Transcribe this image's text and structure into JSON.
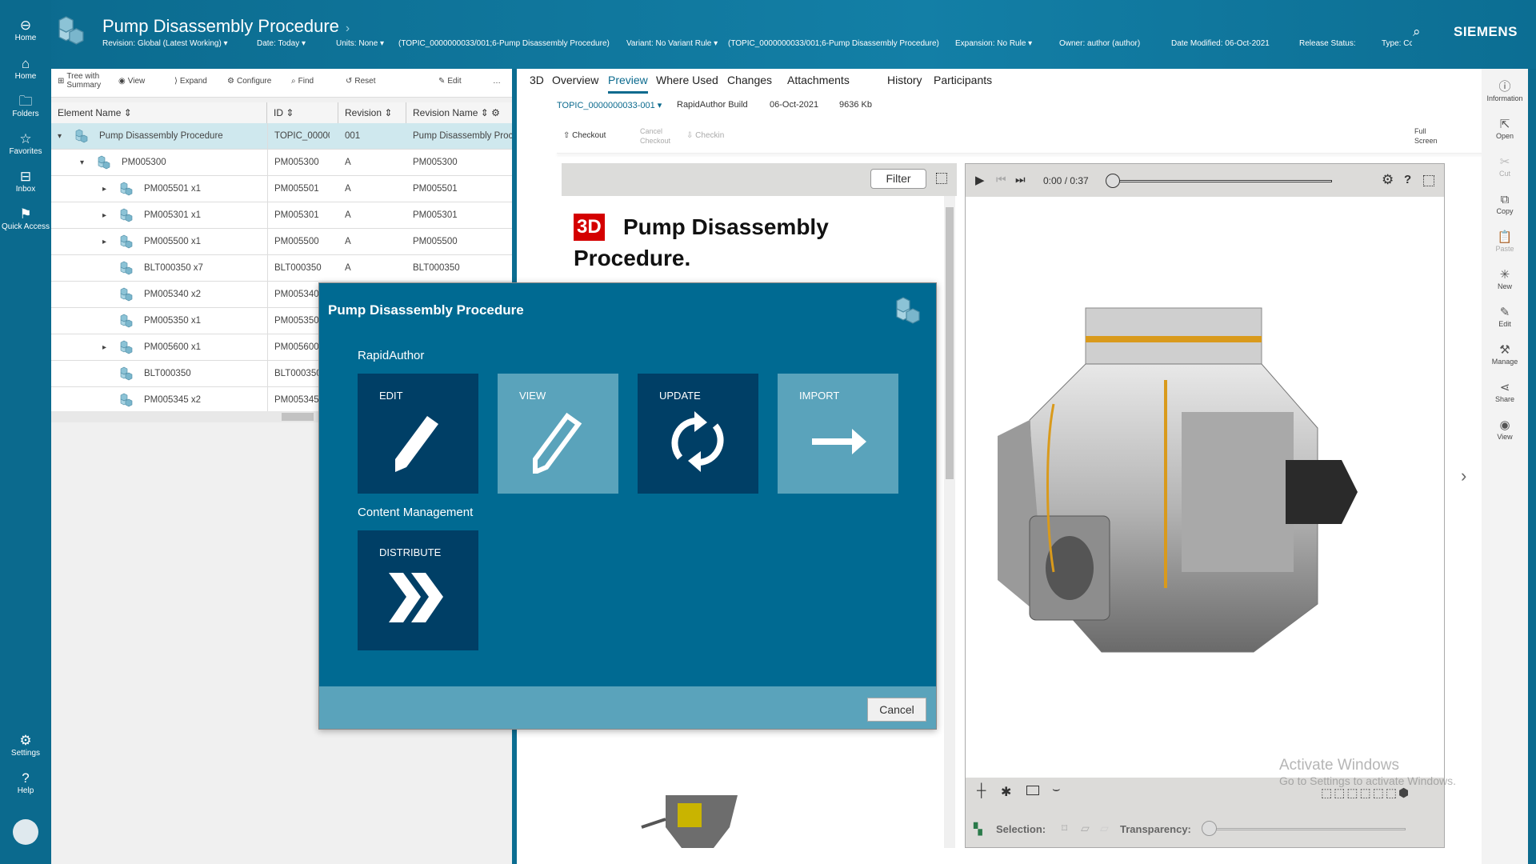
{
  "header": {
    "title": "Pump Disassembly Procedure",
    "brand": "SIEMENS",
    "meta": [
      {
        "label": "Revision:",
        "value": "Global (Latest Working)"
      },
      {
        "label": "Date:",
        "value": "Today"
      },
      {
        "label": "Units:",
        "value": "None"
      },
      {
        "label": "",
        "value": "(TOPIC_0000000033/001;6-Pump Disassembly Procedure)"
      },
      {
        "label": "Variant:",
        "value": "No Variant Rule"
      },
      {
        "label": "",
        "value": "(TOPIC_0000000033/001;6-Pump Disassembly Procedure)"
      },
      {
        "label": "Expansion:",
        "value": "No Rule"
      },
      {
        "label": "Owner:",
        "value": "author (author)"
      },
      {
        "label": "Date Modified:",
        "value": "06-Oct-2021"
      },
      {
        "label": "Release Status:",
        "value": ""
      },
      {
        "label": "Type:",
        "value": "Cc"
      }
    ]
  },
  "leftnav": {
    "items": [
      "Home",
      "Home",
      "Folders",
      "Favorites",
      "Inbox",
      "Quick Access"
    ],
    "bottom": [
      "Settings",
      "Help"
    ]
  },
  "tree_toolbar": {
    "tree": "Tree with Summary",
    "view": "View",
    "expand": "Expand",
    "configure": "Configure",
    "find": "Find",
    "reset": "Reset",
    "edit": "Edit",
    "more": "…"
  },
  "table": {
    "columns": [
      "Element Name",
      "ID",
      "Revision",
      "Revision Name"
    ],
    "rows": [
      {
        "name": "Pump Disassembly Procedure",
        "id": "TOPIC_00000...",
        "rev": "001",
        "revname": "Pump Disassembly Proc",
        "level": 0,
        "toggle": "▾"
      },
      {
        "name": "PM005300",
        "id": "PM005300",
        "rev": "A",
        "revname": "PM005300",
        "level": 1,
        "toggle": "▾"
      },
      {
        "name": "PM005501 x1",
        "id": "PM005501",
        "rev": "A",
        "revname": "PM005501",
        "level": 2,
        "toggle": "▸"
      },
      {
        "name": "PM005301 x1",
        "id": "PM005301",
        "rev": "A",
        "revname": "PM005301",
        "level": 2,
        "toggle": "▸"
      },
      {
        "name": "PM005500 x1",
        "id": "PM005500",
        "rev": "A",
        "revname": "PM005500",
        "level": 2,
        "toggle": "▸"
      },
      {
        "name": "BLT000350 x7",
        "id": "BLT000350",
        "rev": "A",
        "revname": "BLT000350",
        "level": 2,
        "toggle": ""
      },
      {
        "name": "PM005340 x2",
        "id": "PM005340",
        "rev": "",
        "revname": "",
        "level": 2,
        "toggle": ""
      },
      {
        "name": "PM005350 x1",
        "id": "PM005350",
        "rev": "",
        "revname": "",
        "level": 2,
        "toggle": ""
      },
      {
        "name": "PM005600 x1",
        "id": "PM005600",
        "rev": "",
        "revname": "",
        "level": 2,
        "toggle": "▸"
      },
      {
        "name": "BLT000350",
        "id": "BLT000350",
        "rev": "",
        "revname": "",
        "level": 2,
        "toggle": ""
      },
      {
        "name": "PM005345 x2",
        "id": "PM005345",
        "rev": "",
        "revname": "",
        "level": 2,
        "toggle": ""
      }
    ]
  },
  "tabs": [
    "3D",
    "Overview",
    "Preview",
    "Where Used",
    "Changes",
    "Attachments",
    "History",
    "Participants"
  ],
  "active_tab": "Preview",
  "dataset": {
    "name": "TOPIC_0000000033-001",
    "type": "RapidAuthor Build",
    "date": "06-Oct-2021",
    "size": "9636 Kb"
  },
  "doc_toolbar": {
    "checkout": "Checkout",
    "cancel_checkout": "Cancel Checkout",
    "checkin": "Checkin",
    "fullscreen": "Full Screen"
  },
  "doc": {
    "filter": "Filter",
    "badge": "3D",
    "heading": "Pump Disassembly Procedure."
  },
  "video": {
    "time": "0:00 / 0:37",
    "progress": 0,
    "selection": "Selection:",
    "transparency": "Transparency:"
  },
  "right_bar": [
    "Information",
    "Open",
    "Cut",
    "Copy",
    "Paste",
    "New",
    "Edit",
    "Manage",
    "Share",
    "View"
  ],
  "dialog": {
    "title": "Pump Disassembly Procedure",
    "section1": "RapidAuthor",
    "tiles": [
      "EDIT",
      "VIEW",
      "UPDATE",
      "IMPORT"
    ],
    "section2": "Content Management",
    "tile_distribute": "DISTRIBUTE",
    "cancel": "Cancel"
  },
  "watermark": {
    "line1": "Activate Windows",
    "line2": "Go to Settings to activate Windows."
  }
}
